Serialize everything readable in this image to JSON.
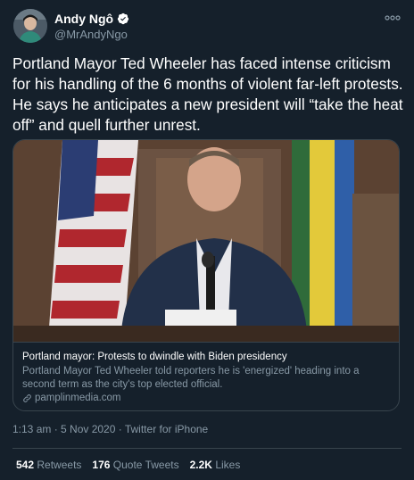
{
  "author": {
    "name": "Andy Ngô",
    "handle": "@MrAndyNgo"
  },
  "tweet": {
    "text": "Portland Mayor Ted Wheeler has faced intense criticism for his handling of the 6 months of violent far-left protests. He says he anticipates a new president will “take the heat off” and quell further unrest."
  },
  "card": {
    "title": "Portland mayor: Protests to dwindle with Biden presidency",
    "description": "Portland Mayor Ted Wheeler told reporters he is 'energized' heading into a second term as the city's top elected official.",
    "domain": "pamplinmedia.com"
  },
  "meta": {
    "timestamp": "1:13 am · 5 Nov 2020 · Twitter for iPhone"
  },
  "stats": {
    "retweets_count": "542",
    "retweets_label": "Retweets",
    "quotes_count": "176",
    "quotes_label": "Quote Tweets",
    "likes_count": "2.2K",
    "likes_label": "Likes"
  },
  "colors": {
    "background": "#15202b",
    "border": "#38444d",
    "secondary_text": "#8899a6",
    "verified": "#ffffff"
  }
}
